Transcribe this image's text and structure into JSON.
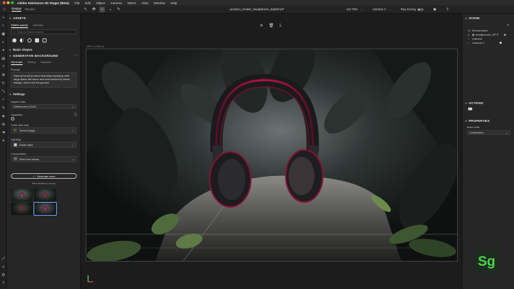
{
  "menubar": {
    "app_title": "Adobe Substance 3D Stager (Beta)",
    "items": [
      "File",
      "Edit",
      "Object",
      "Camera",
      "Select",
      "View",
      "Window",
      "Help"
    ]
  },
  "toolbar": {
    "tabs": [
      "Design",
      "Render"
    ],
    "active_tab": "Design",
    "doc_title": "product_render_headphone_darkbrnd*",
    "zoom": "110.75%",
    "camera": "Camera 2",
    "tracing_label": "Ray tracing"
  },
  "assets_panel": {
    "title": "ASSETS",
    "tabs": [
      "Starter assets",
      "Libraries"
    ],
    "search_placeholder": "Search Starter assets",
    "basic_shapes": "Basic shapes"
  },
  "generative": {
    "title": "GENERATIVE BACKGROUND",
    "tabs": [
      "Generate",
      "History",
      "Samples"
    ],
    "prompt_label": "Prompt",
    "prompt": "Natural toned product branding backdrop with large black flat stone and surrounded by black foliage, view from the ground",
    "settings_label": "Settings",
    "aspect_label": "Aspect ratio",
    "aspect_value": "Widescreen (16:9)",
    "opacity_label": "Opacities",
    "color_label": "Color and tone",
    "color_value": "Toned image",
    "lighting_label": "Lighting",
    "lighting_value": "Studio light",
    "composition_label": "Composition",
    "composition_value": "Shot from below",
    "generate_label": "Generate more",
    "beta_label": "Beta feedback survey"
  },
  "canvas": {
    "size_label": "1920 x 1080 px"
  },
  "scene_panel": {
    "title": "SCENE",
    "items": [
      "Environment",
      "headphones_HP 3",
      "Camera",
      "Camera 2"
    ]
  },
  "actions_panel": {
    "title": "ACTIONS"
  },
  "properties_panel": {
    "title": "PROPERTIES",
    "units_label": "Scene units",
    "units_value": "Centimeters"
  },
  "badge": {
    "label": "Sg"
  },
  "colors": {
    "accent_blue": "#56a0ff",
    "headphone_red": "#c0124a",
    "stager_green": "#49d64a"
  }
}
